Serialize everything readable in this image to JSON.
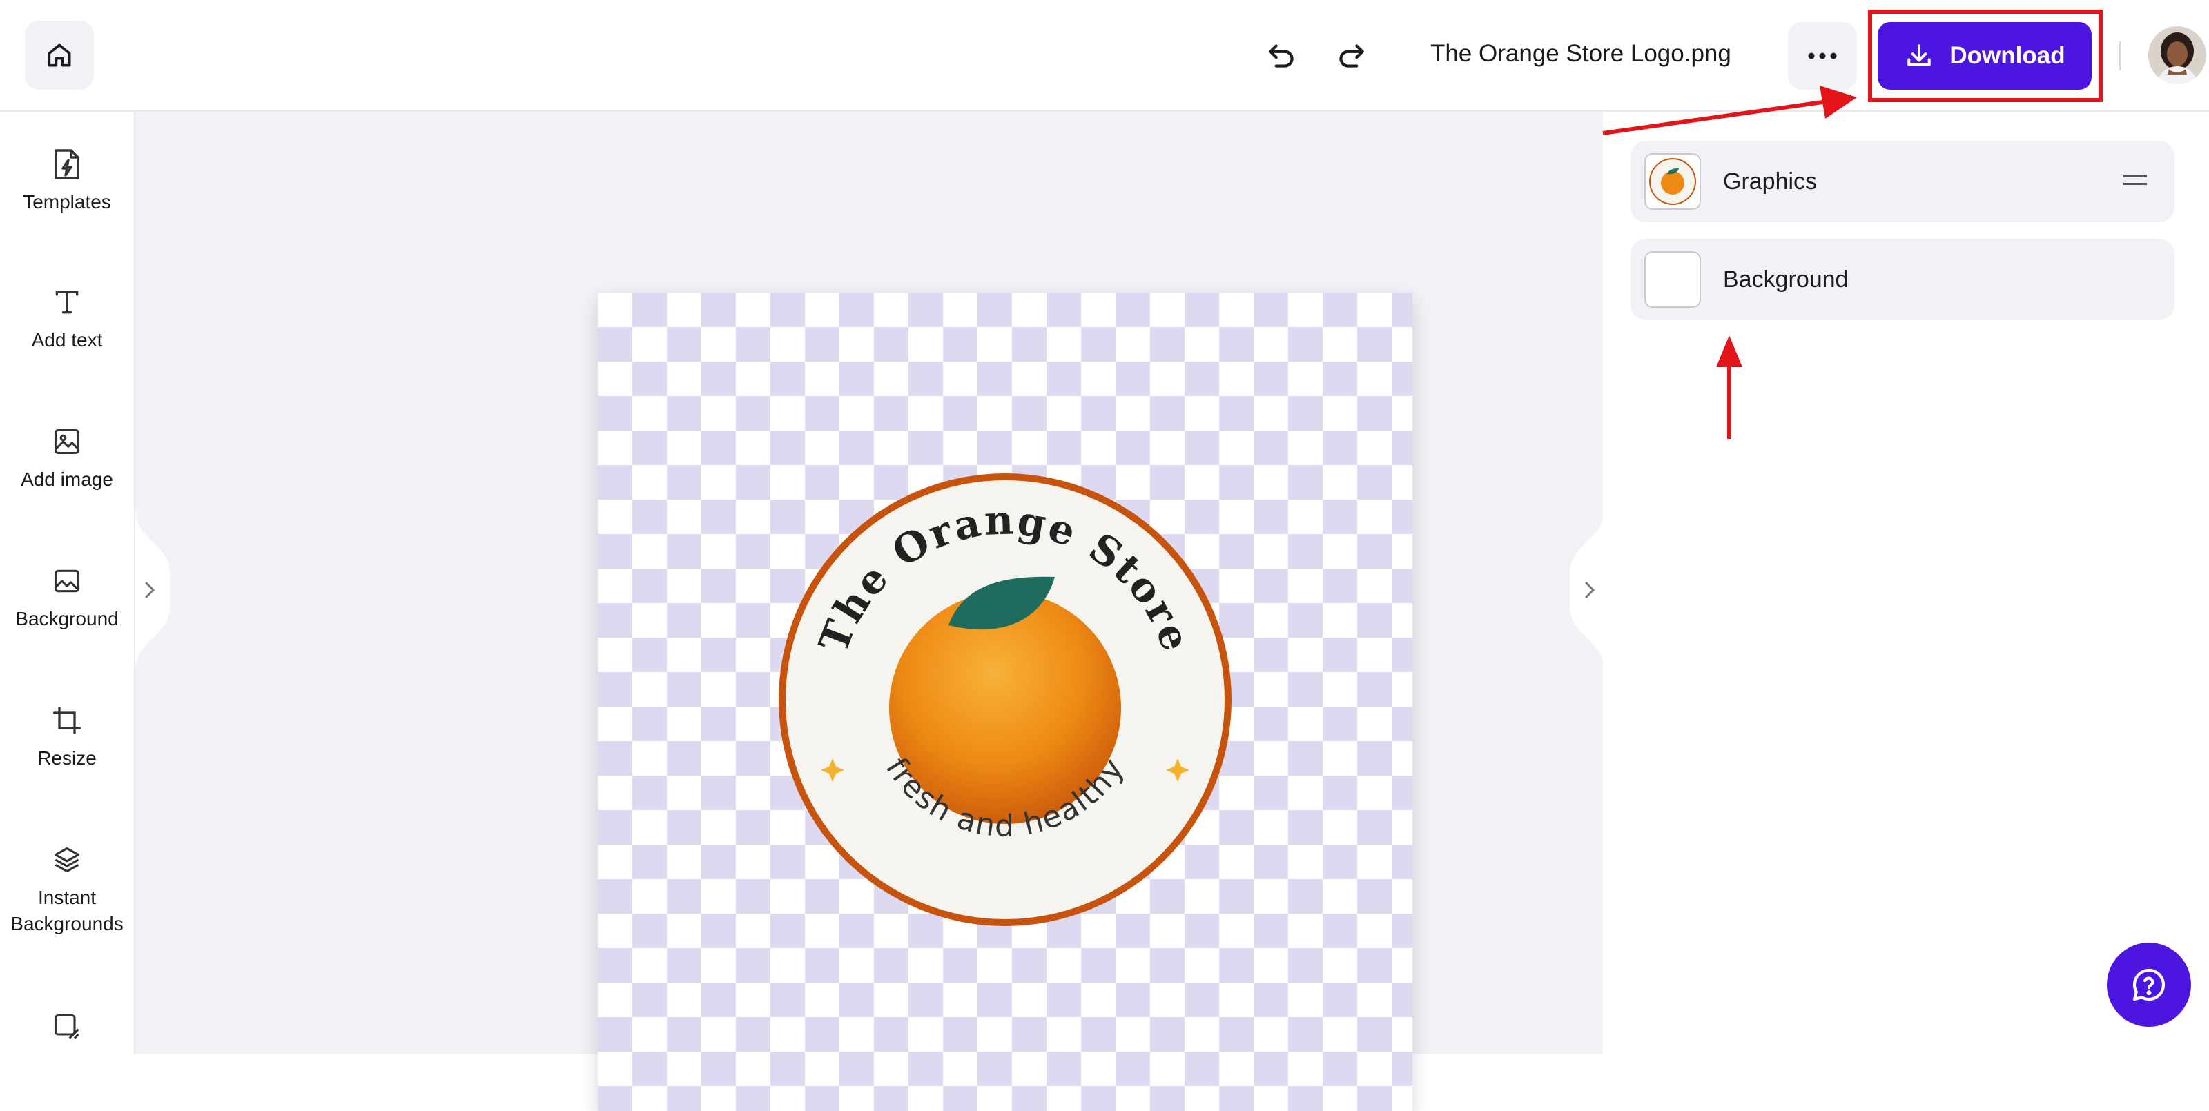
{
  "header": {
    "file_name": "The Orange Store Logo.png",
    "download_label": "Download",
    "icons": {
      "home": "home-icon",
      "undo": "undo-icon",
      "redo": "redo-icon",
      "more": "more-icon",
      "download": "download-icon"
    }
  },
  "left_toolbar": {
    "items": [
      {
        "label": "Templates",
        "icon": "templates-icon"
      },
      {
        "label": "Add text",
        "icon": "text-icon"
      },
      {
        "label": "Add image",
        "icon": "image-icon"
      },
      {
        "label": "Background",
        "icon": "background-icon"
      },
      {
        "label": "Resize",
        "icon": "crop-icon"
      },
      {
        "label": "Instant Backgrounds",
        "icon": "layers-icon"
      }
    ]
  },
  "canvas": {
    "logo": {
      "top_text": "The Orange Store",
      "bottom_text": "fresh and healthy"
    }
  },
  "layers_panel": {
    "items": [
      {
        "name": "Graphics"
      },
      {
        "name": "Background"
      }
    ]
  },
  "colors": {
    "accent": "#4d16e0",
    "annotation_red": "#e3151b",
    "logo_ring": "#c8530d",
    "logo_fill": "#f6f4ef",
    "orange": "#ee8a14",
    "leaf": "#1f6b5e"
  }
}
